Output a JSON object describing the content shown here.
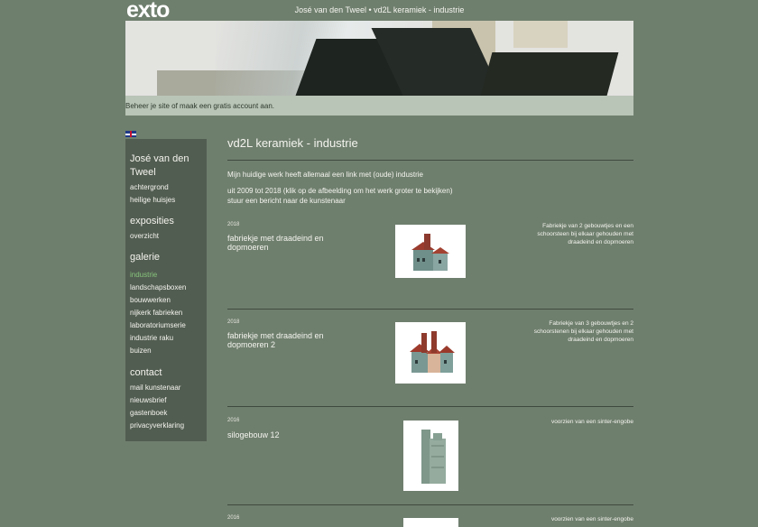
{
  "header": {
    "logo": "exto",
    "site_title": "José van den Tweel • vd2L keramiek - industrie",
    "account_text": "Beheer je site of maak een gratis account aan."
  },
  "sidebar": {
    "language_flag": "uk-flag-icon",
    "name": "José van den Tweel",
    "name_line1": "José van den",
    "name_line2": "Tweel",
    "links_artist": [
      "achtergrond",
      "heilige huisjes"
    ],
    "exposities_heading": "exposities",
    "links_exposities": [
      "overzicht"
    ],
    "galerie_heading": "galerie",
    "links_galerie": [
      "industrie",
      "landschapsboxen",
      "bouwwerken",
      "nijkerk fabrieken",
      "laboratoriumserie",
      "industrie raku",
      "buizen"
    ],
    "active_link": "industrie",
    "contact_heading": "contact",
    "links_contact": [
      "mail kunstenaar",
      "nieuwsbrief",
      "gastenboek",
      "privacyverklaring"
    ]
  },
  "main": {
    "title": "vd2L keramiek - industrie",
    "intro": "Mijn huidige werk heeft allemaal een link met (oude) industrie",
    "period": "uit 2009 tot 2018 (klik op de afbeelding om het werk groter te bekijken)",
    "message_link": "stuur een bericht naar de kunstenaar",
    "works": [
      {
        "year": "2018",
        "title": "fabriekje met draadeind en dopmoeren",
        "description": "Fabriekje van 2 gebouwtjes en een schoorsteen bij elkaar gehouden met draadeind en dopmoeren"
      },
      {
        "year": "2018",
        "title": "fabriekje met draadeind en dopmoeren 2",
        "description": "Fabriekje van 3 gebouwtjes en 2 schoorstenen bij elkaar gehouden met draadeind en dopmoeren"
      },
      {
        "year": "2016",
        "title": "silogebouw 12",
        "description": "voorzien van een sinter-engobe"
      },
      {
        "year": "2016",
        "title": "",
        "description": "voorzien van een sinter-engobe"
      }
    ]
  },
  "colors": {
    "background": "#6f7f6e",
    "sidebar": "#525d51",
    "account_bar": "#b9c5b7",
    "active_link": "#86c47c"
  }
}
